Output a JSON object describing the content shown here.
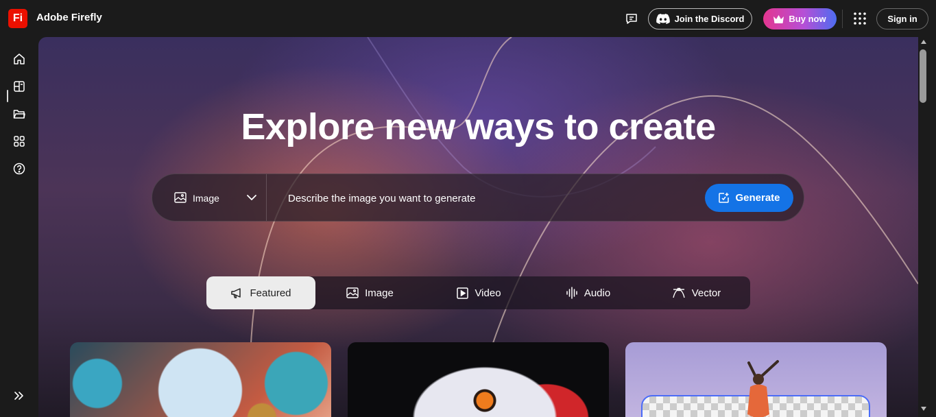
{
  "app": {
    "logo_text": "Fi",
    "title": "Adobe Firefly"
  },
  "header": {
    "discord_label": "Join the Discord",
    "buy_label": "Buy now",
    "signin_label": "Sign in",
    "icons": [
      "feedback-icon",
      "discord-icon",
      "crown-icon",
      "apps-grid-icon"
    ]
  },
  "rail": {
    "items": [
      {
        "name": "home",
        "icon": "home-icon",
        "active": true
      },
      {
        "name": "generate",
        "icon": "generate-icon"
      },
      {
        "name": "files",
        "icon": "folder-icon"
      },
      {
        "name": "apps",
        "icon": "apps-icon"
      },
      {
        "name": "help",
        "icon": "help-icon"
      }
    ],
    "expand_icon": "expand-icon"
  },
  "hero": {
    "title": "Explore new ways to create",
    "type_selected": "Image",
    "prompt_placeholder": "Describe the image you want to generate",
    "generate_label": "Generate"
  },
  "tabs": [
    {
      "label": "Featured",
      "icon": "megaphone-icon",
      "active": true
    },
    {
      "label": "Image",
      "icon": "image-icon"
    },
    {
      "label": "Video",
      "icon": "video-icon"
    },
    {
      "label": "Audio",
      "icon": "audio-icon"
    },
    {
      "label": "Vector",
      "icon": "vector-icon"
    }
  ],
  "colors": {
    "logo": "#eb1000",
    "generate": "#1473e6",
    "buy_gradient": [
      "#e4368f",
      "#b64fd6",
      "#4d6cf0"
    ]
  }
}
